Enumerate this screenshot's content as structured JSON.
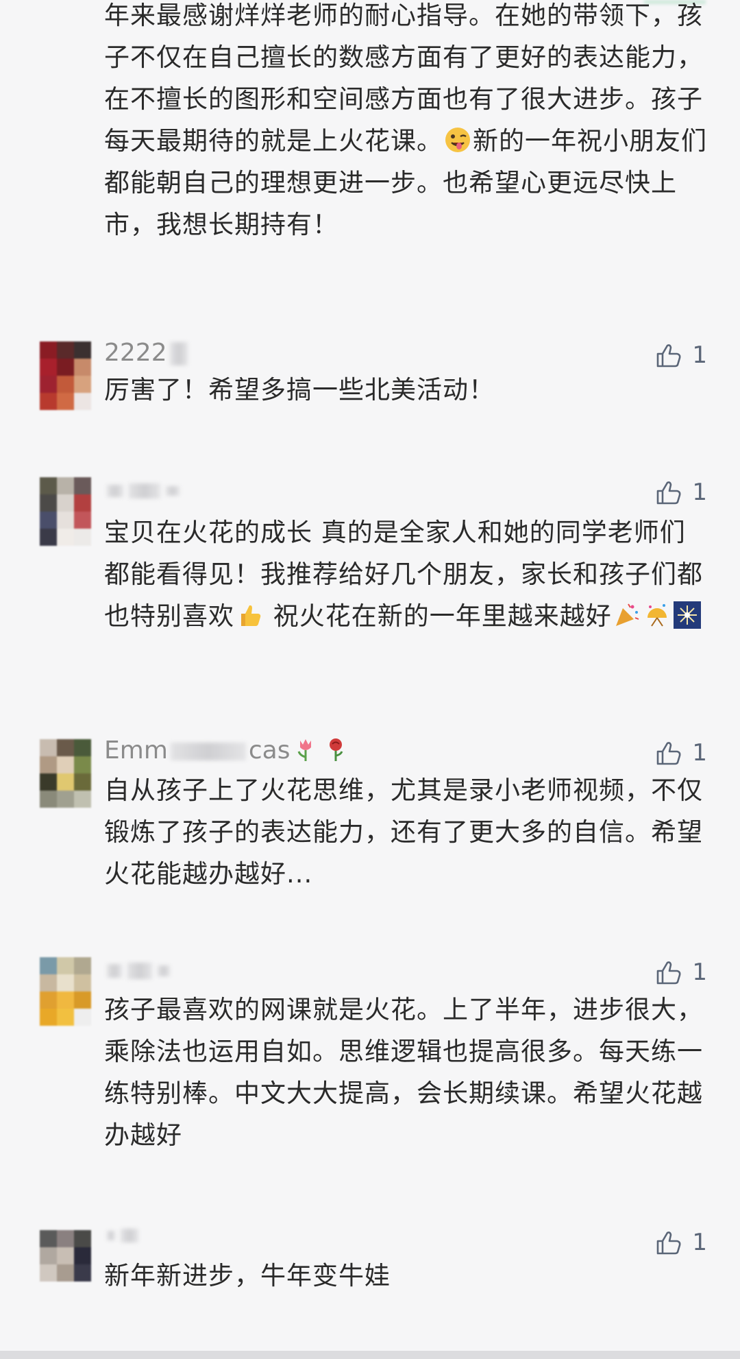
{
  "top_comment": {
    "text_before_emoji": "年来最感谢烊烊老师的耐心指导。在她的带领下，孩子不仅在自己擅长的数感方面有了更好的表达能力，在不擅长的图形和空间感方面也有了很大进步。孩子每天最期待的就是上火花课。",
    "emoji": "winking-tongue-emoji",
    "text_after_emoji": "新的一年祝小朋友们都能朝自己的理想更进一步。也希望心更远尽快上市，我想长期持有！"
  },
  "comments": [
    {
      "name_prefix": "2222",
      "name_suffix": "",
      "likes": "1",
      "text": "厉害了！希望多搞一些北美活动！"
    },
    {
      "name_prefix": "",
      "name_suffix": "",
      "likes": "1",
      "text_part1": "宝贝在火花的成长 真的是全家人和她的同学老师们都能看得见！我推荐给好几个朋友，家长和孩子们都也特别喜欢",
      "text_part2": "  祝火花在新的一年里越来越好",
      "emojis": [
        "thumbs-up-emoji",
        "party-popper-emoji",
        "confetti-emoji",
        "sparkler-emoji"
      ]
    },
    {
      "name_prefix": "Emm",
      "name_suffix": "cas",
      "name_emojis": [
        "tulip-emoji",
        "rose-emoji"
      ],
      "likes": "1",
      "text": "自从孩子上了火花思维，尤其是录小老师视频，不仅锻炼了孩子的表达能力，还有了更大多的自信。希望火花能越办越好..."
    },
    {
      "name_prefix": "",
      "name_suffix": "",
      "likes": "1",
      "text": "孩子最喜欢的网课就是火花。上了半年，进步很大，乘除法也运用自如。思维逻辑也提高很多。每天练一练特别棒。中文大大提高，会长期续课。希望火花越办越好"
    },
    {
      "name_prefix": "",
      "name_suffix": "",
      "likes": "1",
      "text": "新年新进步，牛年变牛娃"
    }
  ],
  "colors": {
    "background": "#f6f6f7",
    "text": "#2a2a2a",
    "name": "#8b8b8b",
    "like_icon": "#5a6577"
  }
}
